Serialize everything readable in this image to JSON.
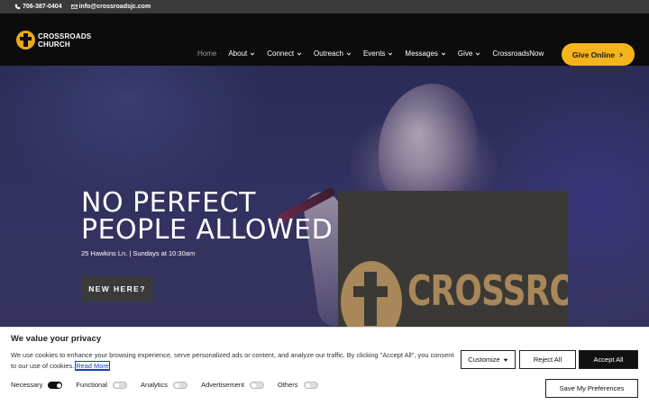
{
  "topbar": {
    "phone": "706-387-0404",
    "email": "info@crossroadsjc.com"
  },
  "logo": {
    "line1": "CROSSROADS",
    "line2": "CHURCH"
  },
  "nav": {
    "items": [
      {
        "label": "Home",
        "active": true,
        "dropdown": false
      },
      {
        "label": "About",
        "dropdown": true
      },
      {
        "label": "Connect",
        "dropdown": true
      },
      {
        "label": "Outreach",
        "dropdown": true
      },
      {
        "label": "Events",
        "dropdown": true
      },
      {
        "label": "Messages",
        "dropdown": true
      },
      {
        "label": "Give",
        "dropdown": true
      },
      {
        "label": "CrossroadsNow",
        "dropdown": false
      }
    ],
    "give_button": "Give Online",
    "give_button_color": "#f4b41c"
  },
  "hero": {
    "title_line1": "NO PERFECT",
    "title_line2": "PEOPLE ALLOWED",
    "subtitle": "25 Hawkins Ln. | Sundays at 10:30am",
    "cta": "NEW HERE?",
    "promo_word": "CROSSROADS"
  },
  "cookie": {
    "title": "We value your privacy",
    "text": "We use cookies to enhance your browsing experience, serve personalized ads or content, and analyze our traffic. By clicking \"Accept All\", you consent to our use of cookies.",
    "link": "Read More",
    "customize": "Customize",
    "reject": "Reject All",
    "accept": "Accept All",
    "save": "Save My Preferences",
    "toggles": [
      {
        "label": "Necessary",
        "on": true
      },
      {
        "label": "Functional",
        "on": false
      },
      {
        "label": "Analytics",
        "on": false
      },
      {
        "label": "Advertisement",
        "on": false
      },
      {
        "label": "Others",
        "on": false
      }
    ]
  }
}
